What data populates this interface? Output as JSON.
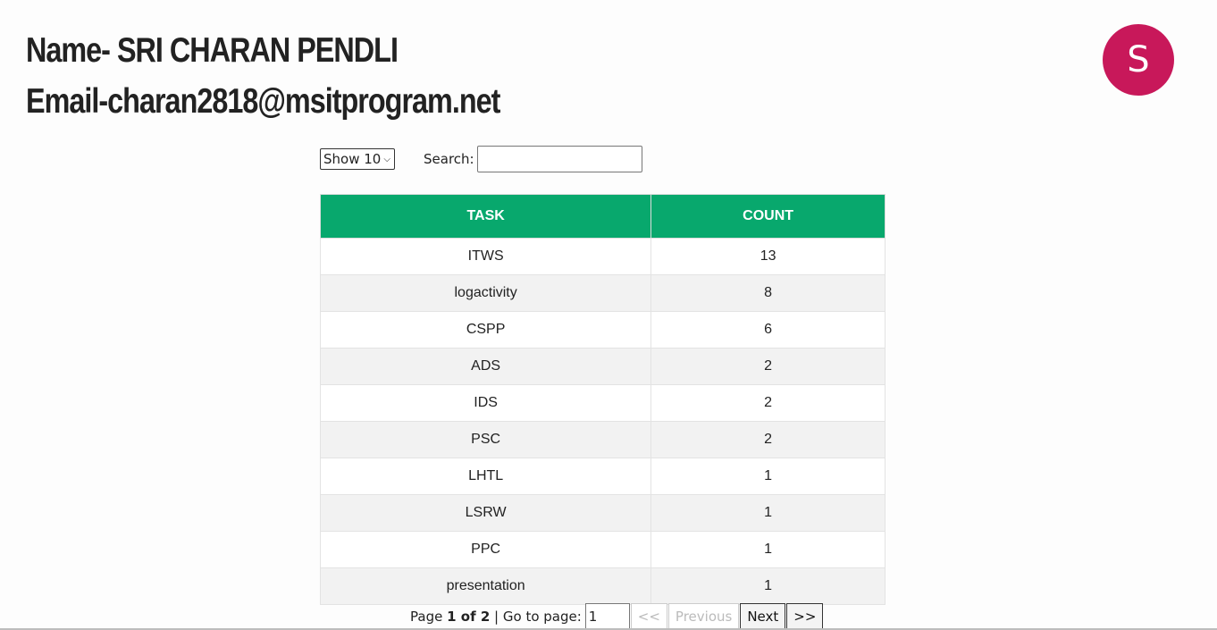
{
  "header": {
    "name_line": "Name- SRI CHARAN PENDLI",
    "email_line": "Email-charan2818@msitprogram.net"
  },
  "avatar": {
    "initial": "S",
    "color": "#c8185a"
  },
  "controls": {
    "show_select": "Show 10",
    "search_label": "Search:",
    "search_value": ""
  },
  "table": {
    "headers": [
      "TASK",
      "COUNT"
    ],
    "header_color": "#08a86d",
    "rows": [
      {
        "task": "ITWS",
        "count": "13"
      },
      {
        "task": "logactivity",
        "count": "8"
      },
      {
        "task": "CSPP",
        "count": "6"
      },
      {
        "task": "ADS",
        "count": "2"
      },
      {
        "task": "IDS",
        "count": "2"
      },
      {
        "task": "PSC",
        "count": "2"
      },
      {
        "task": "LHTL",
        "count": "1"
      },
      {
        "task": "LSRW",
        "count": "1"
      },
      {
        "task": "PPC",
        "count": "1"
      },
      {
        "task": "presentation",
        "count": "1"
      }
    ]
  },
  "pager": {
    "page_word": "Page",
    "page_info": "1 of 2",
    "goto_label": "| Go to page:",
    "goto_value": "1",
    "first": "<<",
    "previous": "Previous",
    "next": "Next",
    "last": ">>"
  }
}
